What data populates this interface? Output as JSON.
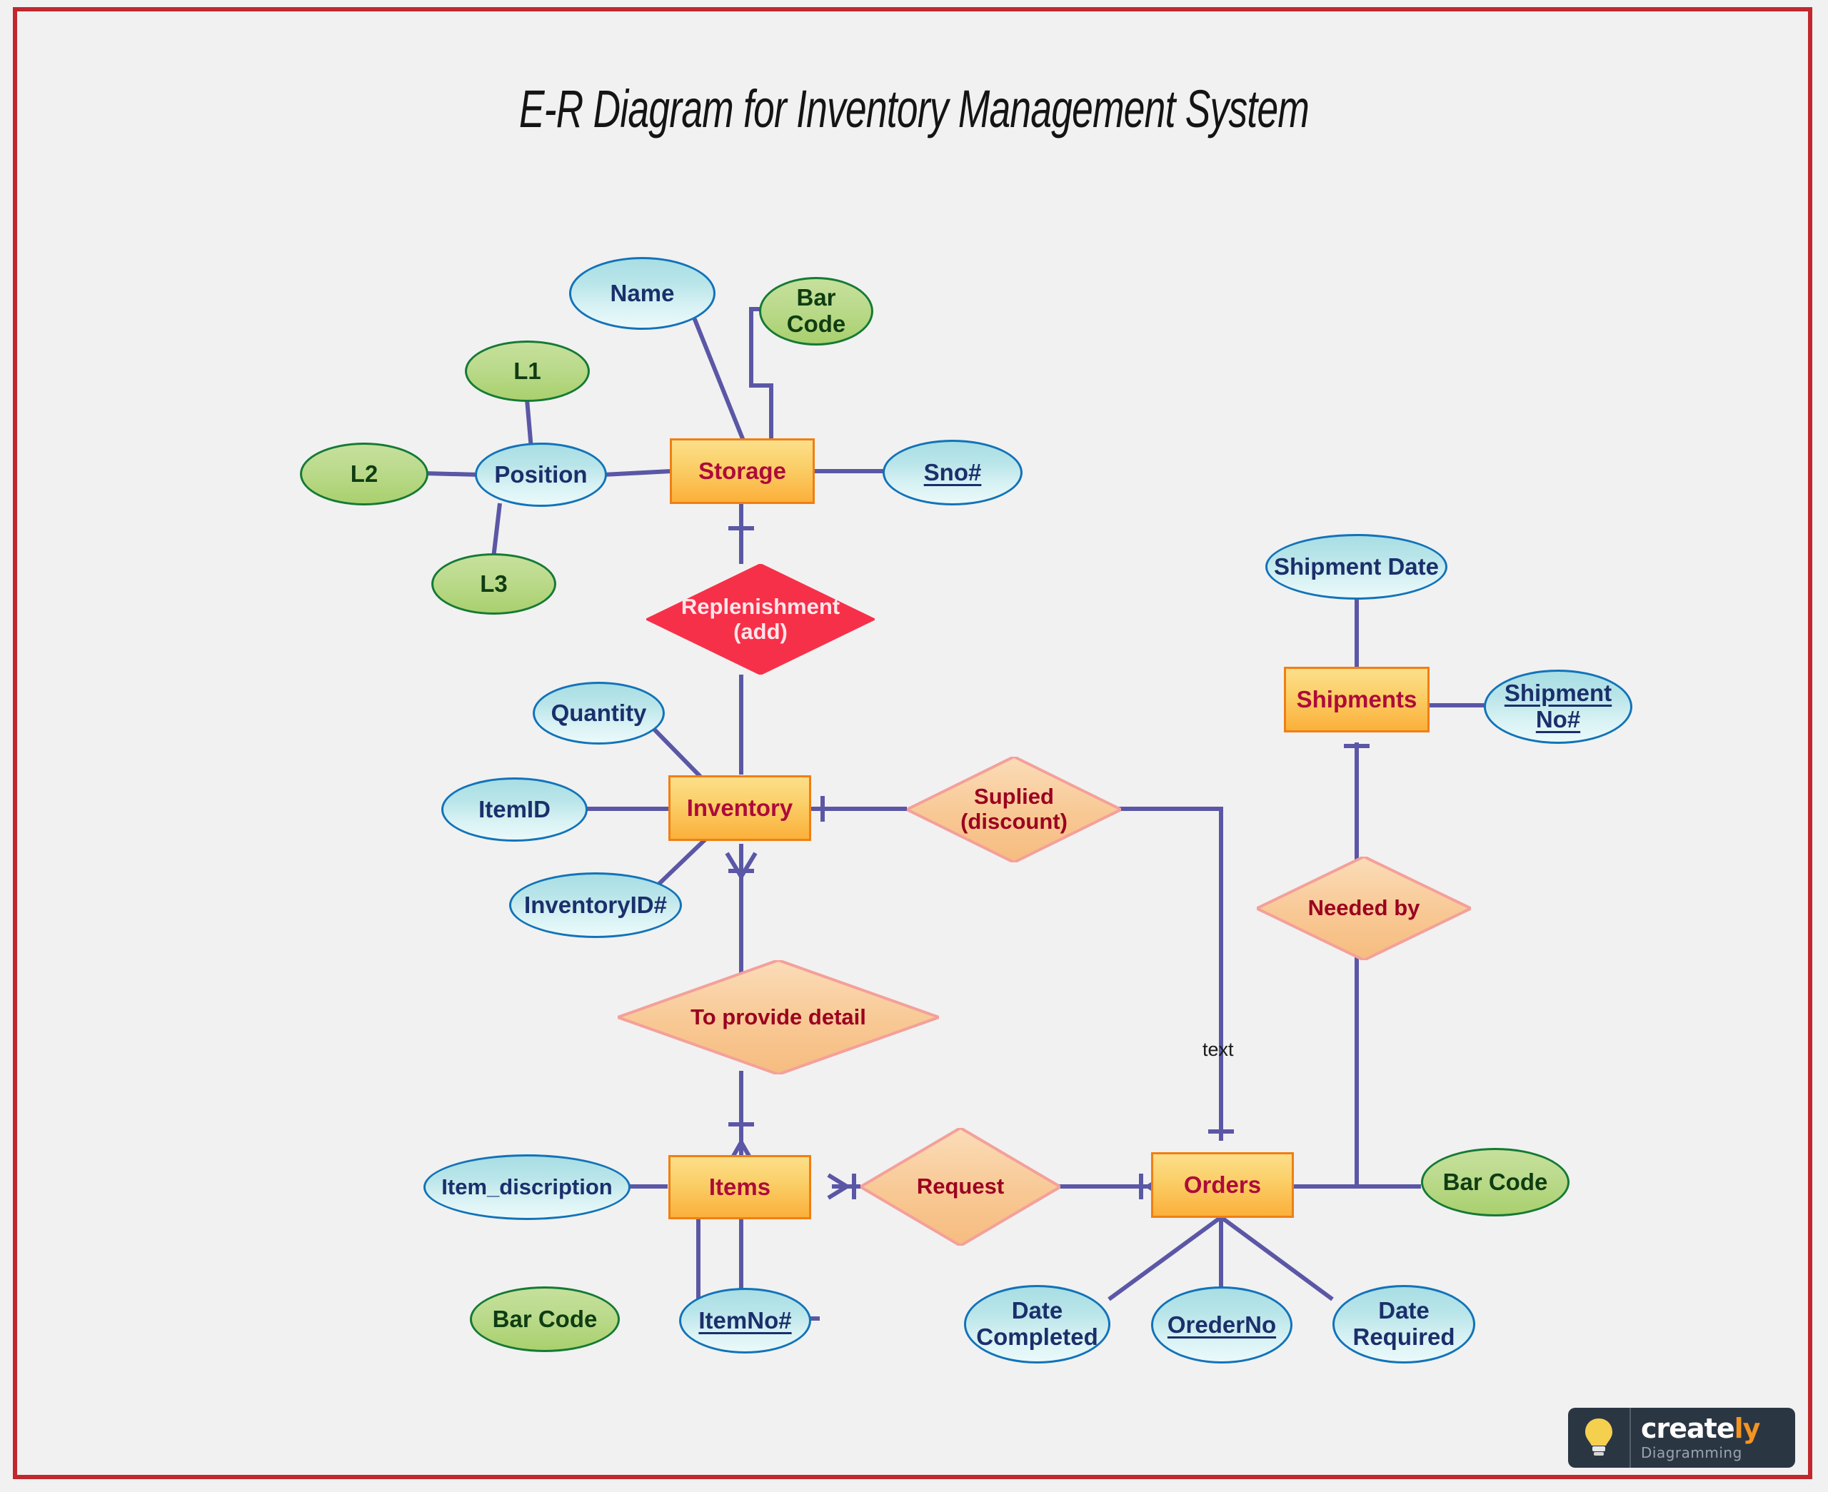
{
  "page": {
    "title": "E-R Diagram for Inventory Management System",
    "background_color": "#f1f1f1",
    "border_color": "#c1272d"
  },
  "palette": {
    "entity_fill": "#fbb03b",
    "entity_border": "#f07f13",
    "entity_text": "#ad0b3a",
    "attribute_blue_fill": "#cdeef1",
    "attribute_blue_border": "#1273b9",
    "attribute_blue_text": "#1b2f6b",
    "attribute_green_fill": "#b5d88a",
    "attribute_green_border": "#157a35",
    "attribute_green_text": "#0f3d12",
    "relationship_fill": "#f8c894",
    "relationship_border": "#f4a09a",
    "relationship_text": "#9b0220",
    "relationship_red_fill": "#f7304a",
    "relationship_red_text": "#fde6ea",
    "connector_color": "#5b57a6"
  },
  "entities": [
    {
      "id": "storage",
      "label": "Storage"
    },
    {
      "id": "inventory",
      "label": "Inventory"
    },
    {
      "id": "items",
      "label": "Items"
    },
    {
      "id": "orders",
      "label": "Orders"
    },
    {
      "id": "shipments",
      "label": "Shipments"
    }
  ],
  "relationships": [
    {
      "id": "replenishment",
      "label": "Replenishment\n(add)",
      "color": "red"
    },
    {
      "id": "suplied",
      "label": "Suplied\n(discount)",
      "color": "peach"
    },
    {
      "id": "to_provide_detail",
      "label": "To provide detail",
      "color": "peach"
    },
    {
      "id": "request",
      "label": "Request",
      "color": "peach"
    },
    {
      "id": "needed_by",
      "label": "Needed by",
      "color": "peach"
    }
  ],
  "attributes": [
    {
      "id": "name",
      "label": "Name",
      "kind": "blue",
      "key": false,
      "owner": "storage"
    },
    {
      "id": "bar_code_storage",
      "label": "Bar\nCode",
      "kind": "green",
      "key": false,
      "owner": "storage"
    },
    {
      "id": "sno",
      "label": "Sno#",
      "kind": "blue",
      "key": true,
      "owner": "storage"
    },
    {
      "id": "position",
      "label": "Position",
      "kind": "blue",
      "key": false,
      "owner": "storage"
    },
    {
      "id": "l1",
      "label": "L1",
      "kind": "green",
      "key": false,
      "owner": "position"
    },
    {
      "id": "l2",
      "label": "L2",
      "kind": "green",
      "key": false,
      "owner": "position"
    },
    {
      "id": "l3",
      "label": "L3",
      "kind": "green",
      "key": false,
      "owner": "position"
    },
    {
      "id": "quantity",
      "label": "Quantity",
      "kind": "blue",
      "key": false,
      "owner": "inventory"
    },
    {
      "id": "item_id",
      "label": "ItemID",
      "kind": "blue",
      "key": false,
      "owner": "inventory"
    },
    {
      "id": "inventory_id",
      "label": "InventoryID#",
      "kind": "blue",
      "key": false,
      "owner": "inventory"
    },
    {
      "id": "item_discription",
      "label": "Item_discription",
      "kind": "blue",
      "key": false,
      "owner": "items"
    },
    {
      "id": "bar_code_items",
      "label": "Bar Code",
      "kind": "green",
      "key": false,
      "owner": "items"
    },
    {
      "id": "item_no",
      "label": "ItemNo#",
      "kind": "blue",
      "key": true,
      "owner": "items"
    },
    {
      "id": "date_completed",
      "label": "Date\nCompleted",
      "kind": "blue",
      "key": false,
      "owner": "orders"
    },
    {
      "id": "oreder_no",
      "label": "OrederNo",
      "kind": "blue",
      "key": true,
      "owner": "orders"
    },
    {
      "id": "date_required",
      "label": "Date\nRequired",
      "kind": "blue",
      "key": false,
      "owner": "orders"
    },
    {
      "id": "bar_code_orders",
      "label": "Bar Code",
      "kind": "green",
      "key": false,
      "owner": "orders"
    },
    {
      "id": "shipment_date",
      "label": "Shipment Date",
      "kind": "blue",
      "key": false,
      "owner": "shipments"
    },
    {
      "id": "shipment_no",
      "label": "Shipment\nNo#",
      "kind": "blue",
      "key": true,
      "owner": "shipments"
    }
  ],
  "edge_labels": [
    {
      "id": "text_label",
      "label": "text"
    }
  ],
  "watermark": {
    "brand_create": "create",
    "brand_ly": "ly",
    "tagline": "Diagramming"
  }
}
